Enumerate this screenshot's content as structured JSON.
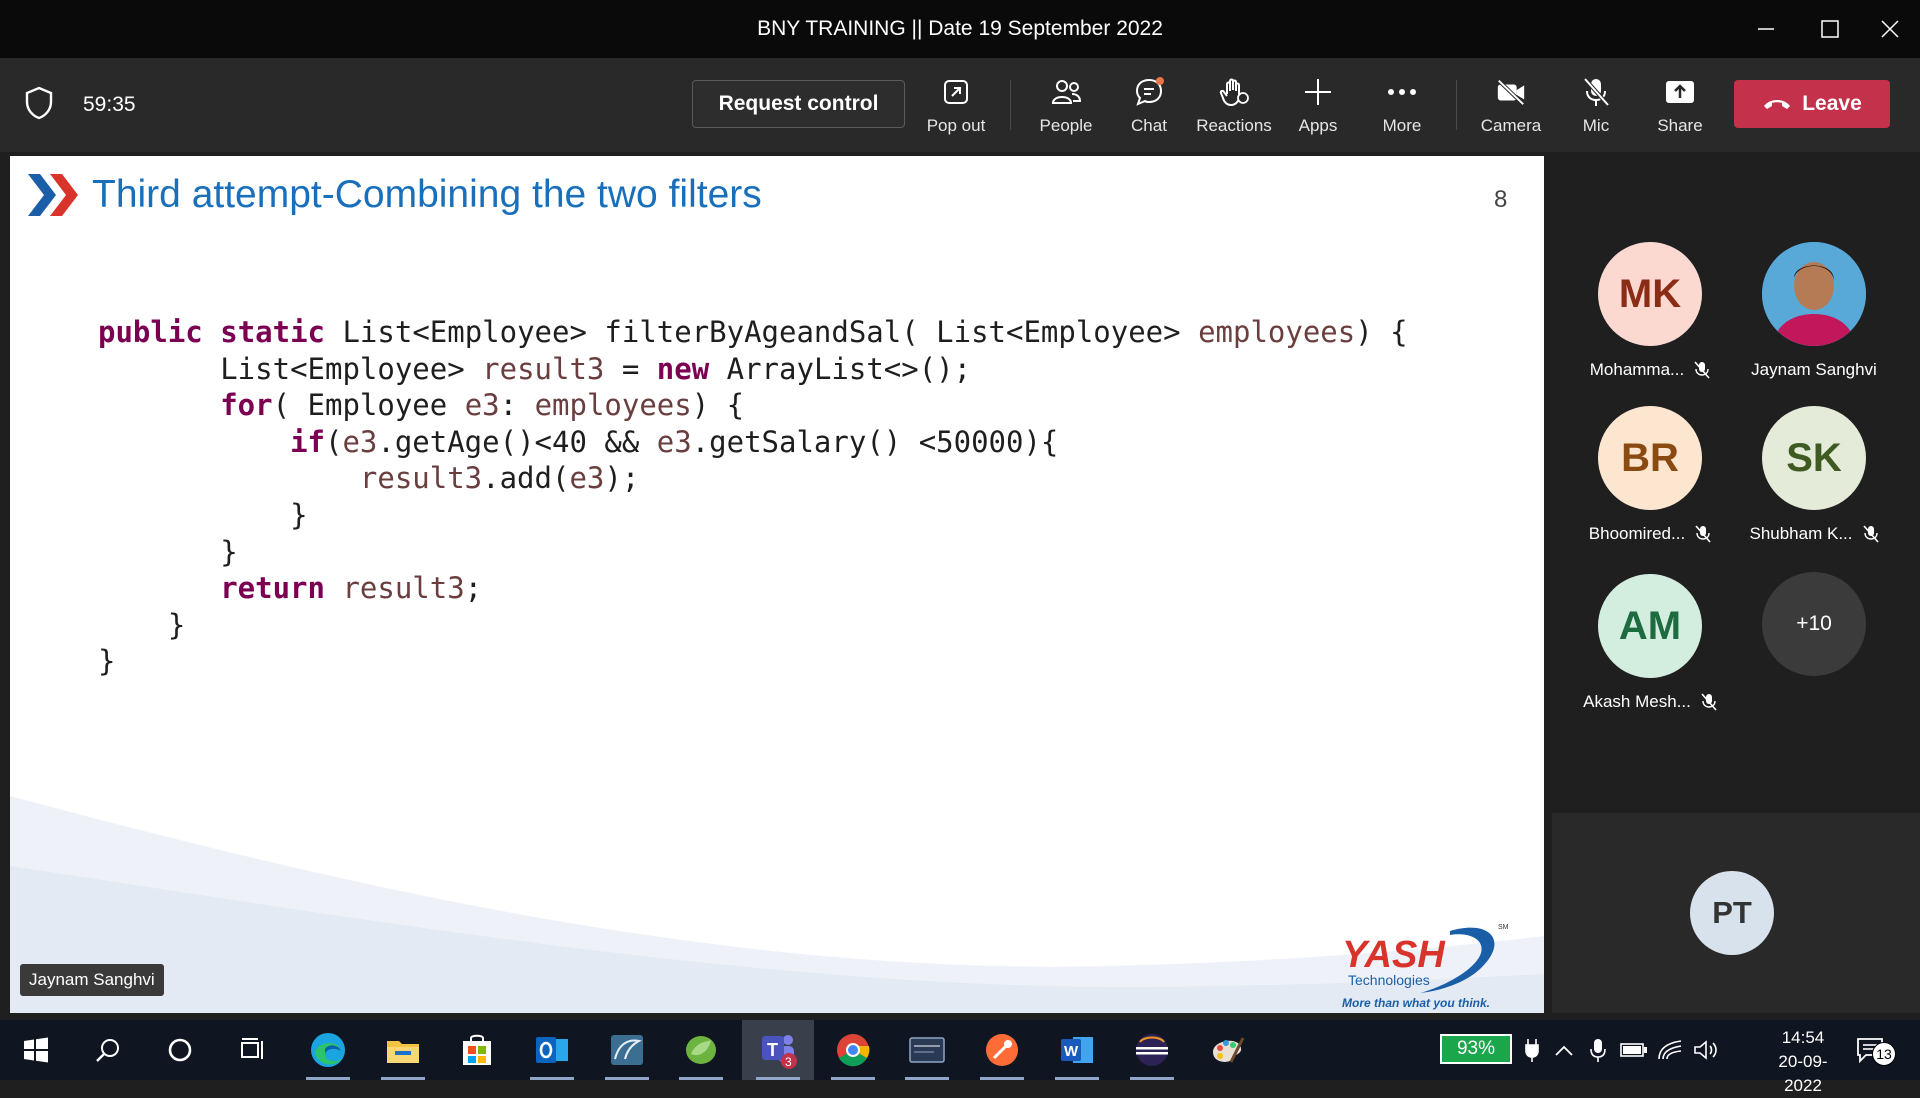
{
  "window": {
    "title": "BNY TRAINING || Date 19 September 2022"
  },
  "toolbar": {
    "timer": "59:35",
    "request_control": "Request control",
    "buttons": [
      {
        "label": "Pop out",
        "icon": "popout-icon"
      },
      {
        "label": "People",
        "icon": "people-icon"
      },
      {
        "label": "Chat",
        "icon": "chat-icon"
      },
      {
        "label": "Reactions",
        "icon": "hand-icon"
      },
      {
        "label": "Apps",
        "icon": "plus-icon"
      },
      {
        "label": "More",
        "icon": "more-icon"
      },
      {
        "label": "Camera",
        "icon": "camera-off-icon"
      },
      {
        "label": "Mic",
        "icon": "mic-off-icon"
      },
      {
        "label": "Share",
        "icon": "share-icon"
      }
    ],
    "leave": "Leave",
    "leave_color": "#c4314b"
  },
  "slide": {
    "title": "Third attempt-Combining the two filters",
    "page_number": "8",
    "code_lines": [
      "public static List<Employee> filterByAgeandSal( List<Employee> employees) {",
      "       List<Employee> result3 = new ArrayList<>();",
      "       for( Employee e3: employees) {",
      "           if(e3.getAge()<40 && e3.getSalary() <50000){",
      "               result3.add(e3);",
      "           }",
      "       }",
      "       return result3;",
      "    }",
      "}"
    ],
    "logo": {
      "name": "YASH",
      "sub": "Technologies",
      "tagline": "More than what you think.",
      "mark": "SM"
    },
    "presenter": "Jaynam Sanghvi",
    "title_color": "#1a6fba"
  },
  "participants": [
    {
      "initials": "MK",
      "name": "Mohamma...",
      "muted": true,
      "bg": "#fbd9d1",
      "fg": "#8b2c16"
    },
    {
      "initials": "",
      "name": "Jaynam Sanghvi",
      "muted": false,
      "photo": true
    },
    {
      "initials": "BR",
      "name": "Bhoomired...",
      "muted": true,
      "bg": "#fde6cf",
      "fg": "#8a4b13"
    },
    {
      "initials": "SK",
      "name": "Shubham K...",
      "muted": true,
      "bg": "#e4ebd9",
      "fg": "#3f5a22"
    },
    {
      "initials": "AM",
      "name": "Akash Mesh...",
      "muted": true,
      "bg": "#d3eedf",
      "fg": "#1d6b3f"
    }
  ],
  "overflow_count": "+10",
  "self": {
    "initials": "PT"
  },
  "taskbar": {
    "apps": [
      "start-icon",
      "search-icon",
      "cortana-icon",
      "task-view-icon",
      "edge-icon",
      "file-explorer-icon",
      "store-icon",
      "outlook-icon",
      "mysql-workbench-icon",
      "spring-tools-icon",
      "teams-icon",
      "chrome-icon",
      "mysql-icon",
      "postman-icon",
      "word-icon",
      "eclipse-icon",
      "paint-icon"
    ],
    "teams_badge": "3",
    "battery": "93%",
    "time": "14:54",
    "date": "20-09-2022",
    "notifications": "13"
  }
}
